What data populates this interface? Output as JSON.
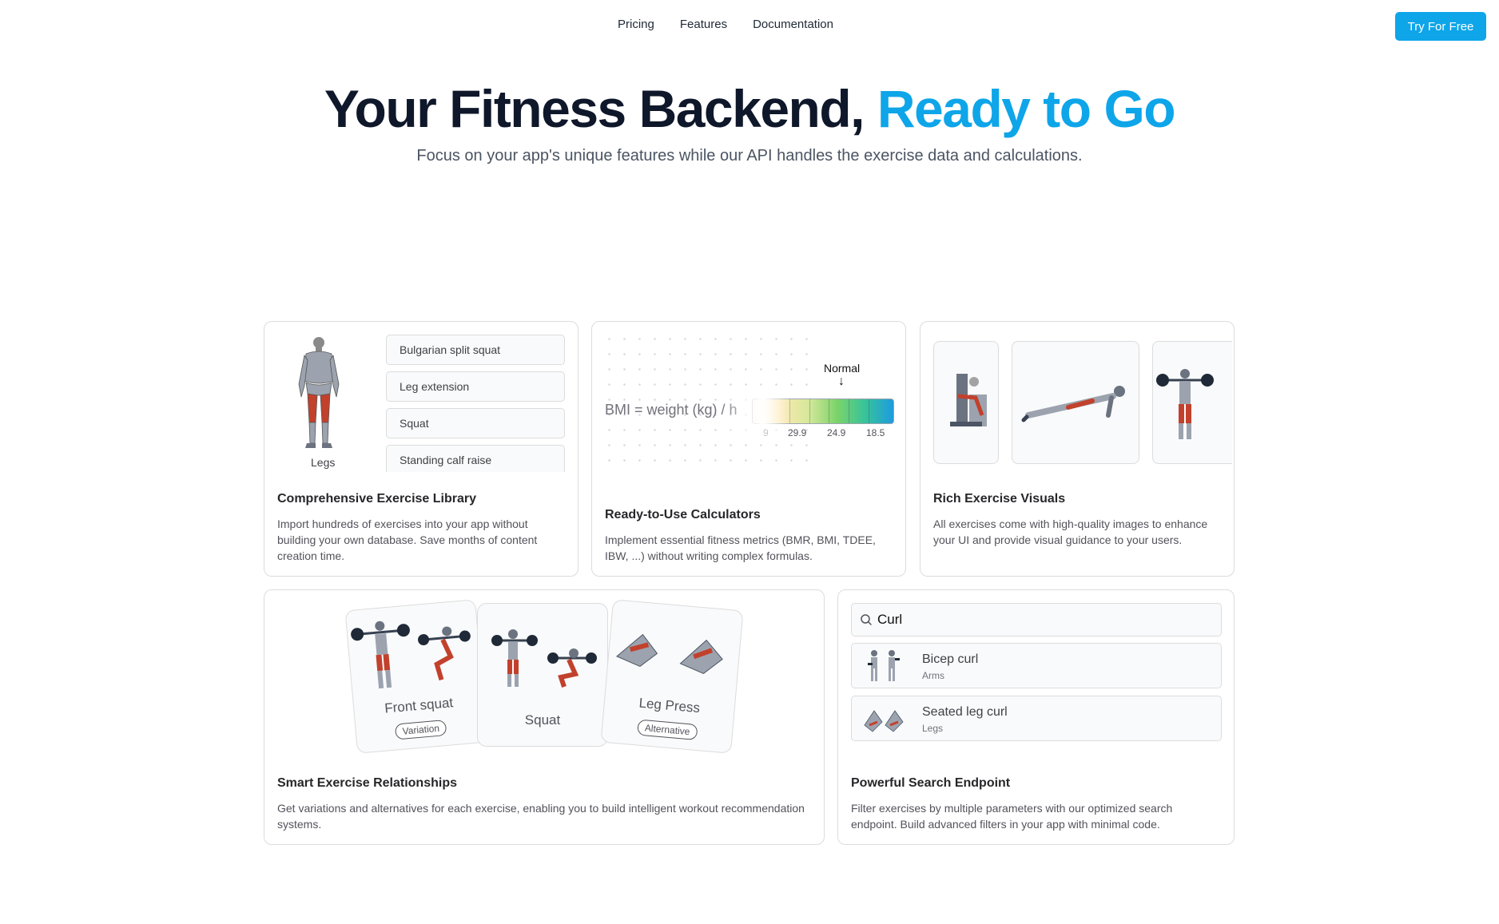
{
  "nav": {
    "links": [
      "Pricing",
      "Features",
      "Documentation"
    ],
    "cta_label": "Try For Free"
  },
  "hero": {
    "title_main": "Your Fitness Backend,",
    "title_accent": "Ready to Go",
    "subtitle": "Focus on your app's unique features while our API handles the exercise data and calculations."
  },
  "features": {
    "library": {
      "muscle_label": "Legs",
      "exercises": [
        "Bulgarian split squat",
        "Leg extension",
        "Squat",
        "Standing calf raise"
      ],
      "title": "Comprehensive Exercise Library",
      "description": "Import hundreds of exercises into your app without building your own database. Save months of content creation time."
    },
    "calculators": {
      "formula": "BMI = weight (kg) / h",
      "marker_label": "Normal",
      "ticks": [
        "9",
        "29.9",
        "24.9",
        "18.5"
      ],
      "title": "Ready-to-Use Calculators",
      "description": "Implement essential fitness metrics (BMR, BMI, TDEE, IBW, ...) without writing complex formulas."
    },
    "visuals": {
      "title": "Rich Exercise Visuals",
      "description": "All exercises come with high-quality images to enhance your UI and provide visual guidance to your users."
    },
    "relationships": {
      "cards": [
        {
          "name": "Front squat",
          "badge": "Variation"
        },
        {
          "name": "Squat",
          "badge": ""
        },
        {
          "name": "Leg Press",
          "badge": "Alternative"
        }
      ],
      "title": "Smart Exercise Relationships",
      "description": "Get variations and alternatives for each exercise, enabling you to build intelligent workout recommendation systems."
    },
    "search": {
      "query": "Curl",
      "results": [
        {
          "name": "Bicep curl",
          "category": "Arms"
        },
        {
          "name": "Seated leg curl",
          "category": "Legs"
        }
      ],
      "title": "Powerful Search Endpoint",
      "description": "Filter exercises by multiple parameters with our optimized search endpoint. Build advanced filters in your app with minimal code."
    }
  },
  "colors": {
    "accent": "#0ea5e9",
    "heading": "#0f172a",
    "muscle_highlight": "#c2412d"
  }
}
